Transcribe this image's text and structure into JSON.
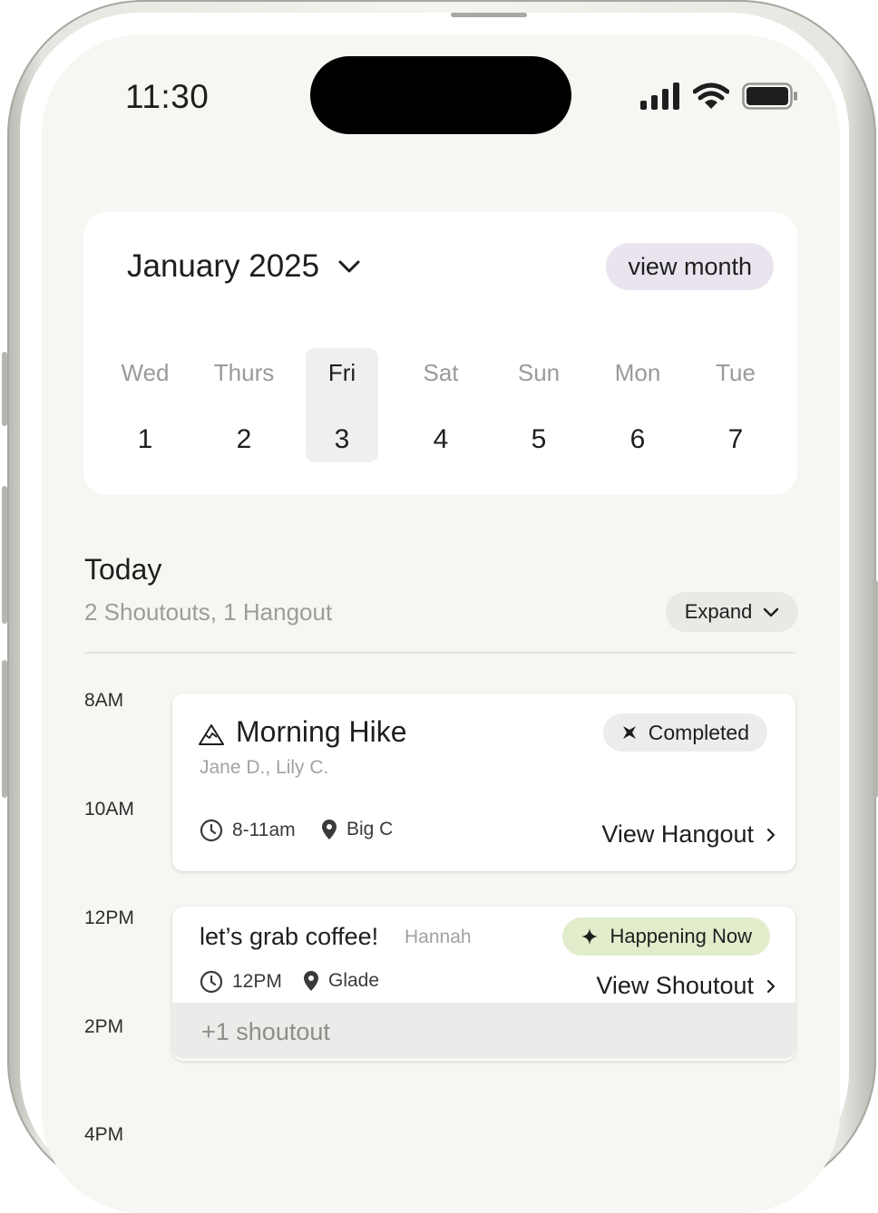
{
  "status_bar": {
    "time": "11:30"
  },
  "calendar": {
    "month_label": "January 2025",
    "view_month_label": "view month",
    "days": [
      {
        "name": "Wed",
        "num": "1",
        "selected": false
      },
      {
        "name": "Thurs",
        "num": "2",
        "selected": false
      },
      {
        "name": "Fri",
        "num": "3",
        "selected": true
      },
      {
        "name": "Sat",
        "num": "4",
        "selected": false
      },
      {
        "name": "Sun",
        "num": "5",
        "selected": false
      },
      {
        "name": "Mon",
        "num": "6",
        "selected": false
      },
      {
        "name": "Tue",
        "num": "7",
        "selected": false
      }
    ]
  },
  "today": {
    "title": "Today",
    "summary": "2 Shoutouts, 1 Hangout",
    "expand_label": "Expand"
  },
  "timeline": {
    "labels": [
      "8AM",
      "10AM",
      "12PM",
      "2PM",
      "4PM"
    ]
  },
  "hangout": {
    "title": "Morning Hike",
    "people": "Jane D., Lily C.",
    "status": "Completed",
    "time": "8-11am",
    "location": "Big C",
    "view_label": "View Hangout"
  },
  "shoutout": {
    "title": "let’s grab coffee!",
    "host": "Hannah",
    "status": "Happening Now",
    "time": "12PM",
    "location": "Glade",
    "view_label": "View Shoutout"
  },
  "more": {
    "label": "+1 shoutout"
  },
  "colors": {
    "screen_bg": "#f6f6f2",
    "view_month_bg": "#e9e4ee",
    "happening_now_bg": "#e1edcb",
    "completed_bg": "#ececea"
  }
}
